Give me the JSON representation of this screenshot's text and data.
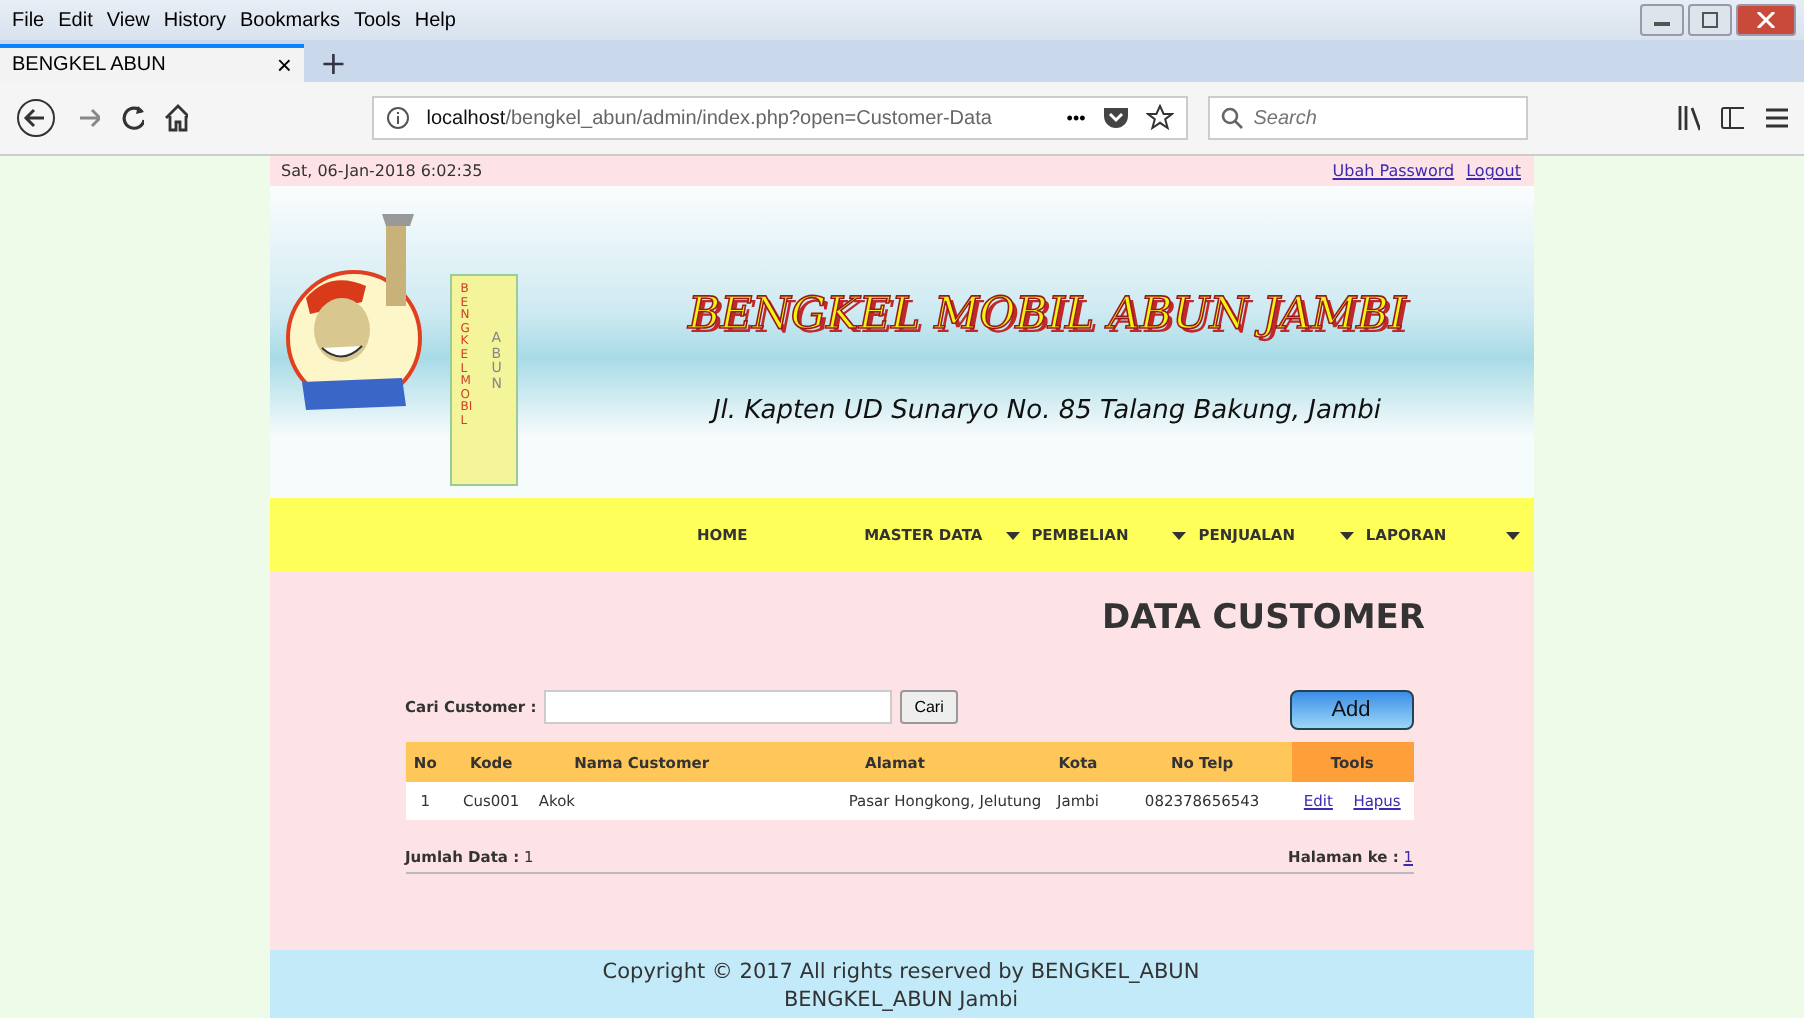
{
  "menu_bar": [
    "File",
    "Edit",
    "View",
    "History",
    "Bookmarks",
    "Tools",
    "Help"
  ],
  "tab": {
    "title": "BENGKEL ABUN",
    "close": "×",
    "new_tab": "+"
  },
  "address_bar": {
    "host": "localhost",
    "path": "/bengkel_abun/admin/index.php?open=Customer-Data",
    "more": "•••"
  },
  "search": {
    "placeholder": "Search"
  },
  "top_bar": {
    "datetime": "Sat, 06-Jan-2018 6:02:35",
    "links": [
      "Ubah Password",
      "Logout"
    ]
  },
  "banner": {
    "logo_text": [
      "BENGKEL MOBIL",
      "ABUN"
    ],
    "title": "BENGKEL MOBIL ABUN JAMBI",
    "address": "Jl. Kapten UD Sunaryo No. 85 Talang Bakung, Jambi"
  },
  "nav": [
    {
      "label": "HOME",
      "dropdown": false
    },
    {
      "label": "MASTER DATA",
      "dropdown": true
    },
    {
      "label": "PEMBELIAN",
      "dropdown": true
    },
    {
      "label": "PENJUALAN",
      "dropdown": true
    },
    {
      "label": "LAPORAN",
      "dropdown": true
    }
  ],
  "page_title": "DATA CUSTOMER",
  "search_form": {
    "label": "Cari Customer :",
    "button": "Cari"
  },
  "add_button": "Add",
  "table": {
    "columns": [
      "No",
      "Kode",
      "Nama Customer",
      "Alamat",
      "Kota",
      "No Telp",
      "Tools"
    ],
    "rows": [
      {
        "cells": [
          "1",
          "Cus001",
          "Akok",
          "Pasar Hongkong, Jelutung",
          "Jambi",
          "082378656543"
        ],
        "actions": [
          "Edit",
          "Hapus"
        ]
      }
    ]
  },
  "summary": {
    "count_label": "Jumlah Data :",
    "count": "1",
    "page_label": "Halaman ke :",
    "pages": [
      "1"
    ]
  },
  "footer": [
    "Copyright © 2017 All rights reserved by BENGKEL_ABUN",
    "BENGKEL_ABUN Jambi"
  ]
}
